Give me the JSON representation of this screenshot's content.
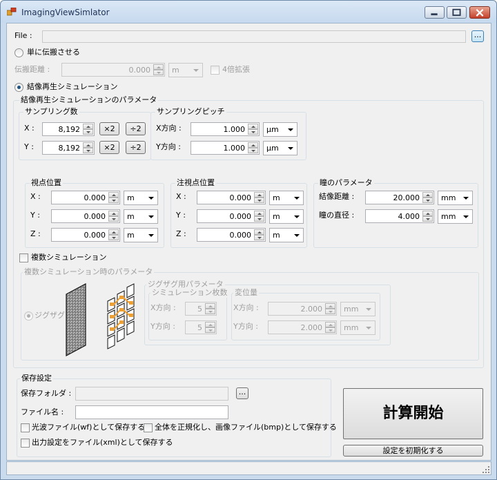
{
  "window": {
    "title": "ImagingViewSimlator"
  },
  "file": {
    "label": "File :",
    "value": "",
    "browse_label": "..."
  },
  "simple": {
    "radio_label": "単に伝搬させる",
    "distance_label": "伝搬距離 :",
    "distance_value": "0.000",
    "distance_unit": "m",
    "expand_label": "4倍拡張"
  },
  "imaging": {
    "radio_label": "結像再生シミュレーション",
    "params_label": "結像再生シミュレーションのパラメータ",
    "sampling_count": {
      "label": "サンプリング数",
      "x_label": "X :",
      "x_value": "8,192",
      "y_label": "Y :",
      "y_value": "8,192",
      "times2_label": "×2",
      "div2_label": "÷2"
    },
    "sampling_pitch": {
      "label": "サンプリングピッチ",
      "x_label": "X方向 :",
      "x_value": "1.000",
      "x_unit": "μm",
      "y_label": "Y方向 :",
      "y_value": "1.000",
      "y_unit": "μm"
    },
    "viewpoint": {
      "label": "視点位置",
      "x_label": "X :",
      "x_value": "0.000",
      "x_unit": "m",
      "y_label": "Y :",
      "y_value": "0.000",
      "y_unit": "m",
      "z_label": "Z :",
      "z_value": "0.000",
      "z_unit": "m"
    },
    "gaze": {
      "label": "注視点位置",
      "x_label": "X :",
      "x_value": "0.000",
      "x_unit": "m",
      "y_label": "Y :",
      "y_value": "0.000",
      "y_unit": "m",
      "z_label": "Z :",
      "z_value": "0.000",
      "z_unit": "m"
    },
    "eye": {
      "label": "瞳のパラメータ",
      "distance_label": "結像距離 :",
      "distance_value": "20.000",
      "distance_unit": "mm",
      "diameter_label": "瞳の直径 :",
      "diameter_value": "4.000",
      "diameter_unit": "mm"
    },
    "multi": {
      "check_label": "複数シミュレーション",
      "params_label": "複数シミュレーション時のパラメータ",
      "zigzag_label": "ジグザグ",
      "zigzag_params_label": "ジグザグ用パラメータ",
      "count": {
        "label": "シミュレーション枚数",
        "x_label": "X方向 :",
        "x_value": "5",
        "y_label": "Y方向 :",
        "y_value": "5"
      },
      "displacement": {
        "label": "変位量",
        "x_label": "X方向 :",
        "x_value": "2.000",
        "x_unit": "mm",
        "y_label": "Y方向 :",
        "y_value": "2.000",
        "y_unit": "mm"
      }
    }
  },
  "save": {
    "group_label": "保存設定",
    "folder_label": "保存フォルダ :",
    "folder_value": "",
    "browse_label": "...",
    "filename_label": "ファイル名 :",
    "filename_value": "",
    "wave_check_label": "光波ファイル(wf)として保存する",
    "normalize_check_label": "全体を正規化し、画像ファイル(bmp)として保存する",
    "xml_check_label": "出力設定をファイル(xml)として保存する"
  },
  "actions": {
    "start_label": "計算開始",
    "reset_label": "設定を初期化する"
  },
  "colors": {
    "accent": "#1c5180",
    "disabled_text": "#9e9e9e",
    "orange": "#f0a030"
  }
}
